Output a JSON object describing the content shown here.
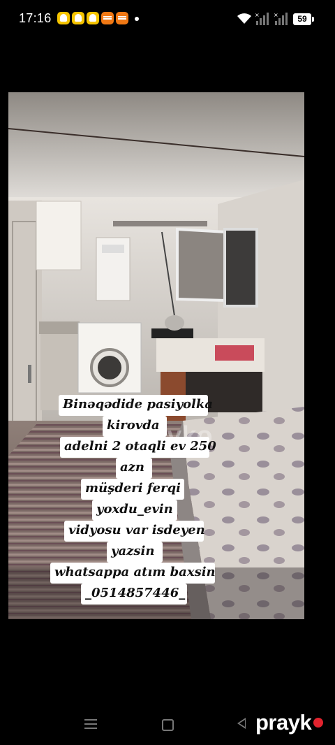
{
  "status_bar": {
    "time": "17:16",
    "notification_icons": [
      "snapchat-icon",
      "snapchat-icon",
      "snapchat-icon",
      "temu-icon",
      "temu-icon"
    ],
    "battery": "59"
  },
  "video": {
    "caption_lines": [
      "Binəqədide pasiyolka",
      "kirovda",
      "adelni 2 otaqli ev 250",
      "azn",
      "müşderi ferqi",
      "yoxdu_evin",
      "vidyosu var isdeyen",
      "yazsin",
      "whatsappa atım baxsin",
      "_0514857446_"
    ],
    "watermark": "prayko"
  },
  "nav_bar": {
    "brand": "prayk",
    "brand_color": "#e2232e"
  }
}
